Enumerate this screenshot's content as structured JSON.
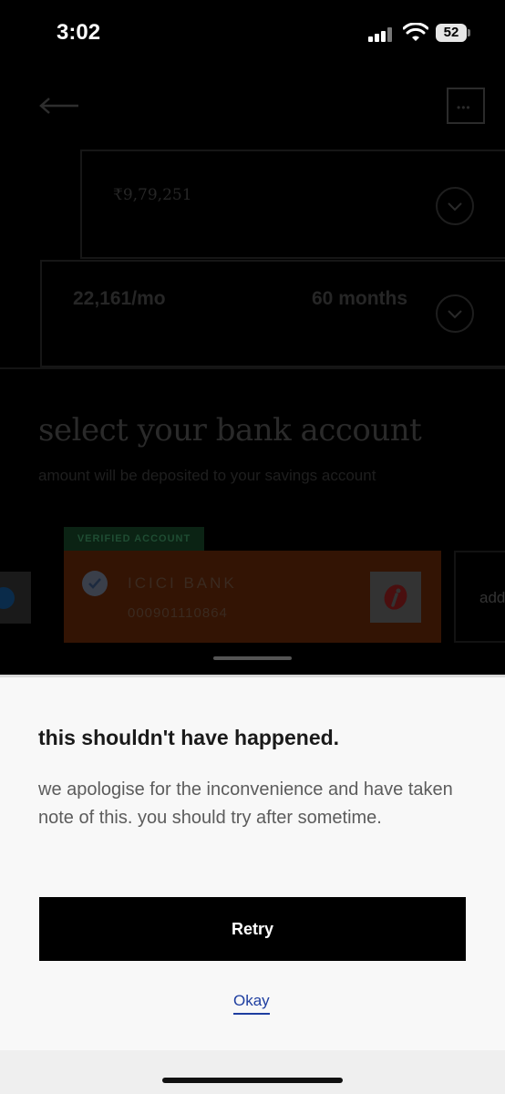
{
  "status_bar": {
    "time": "3:02",
    "battery": "52",
    "icons": [
      "cellular-signal-icon",
      "wifi-icon",
      "battery-icon"
    ]
  },
  "header": {
    "icons": [
      "back-arrow-icon",
      "chat-icon"
    ]
  },
  "loan": {
    "amount": "₹9,79,251",
    "emi": "22,161/mo",
    "tenure": "60 months"
  },
  "bank_section": {
    "title": "select your bank account",
    "subtitle": "amount will be deposited to your savings account",
    "verified_badge": "VERIFIED ACCOUNT",
    "bank_name": "ICICI BANK",
    "account_number": "000901110864",
    "next_card_label": "add"
  },
  "modal": {
    "title": "this shouldn't have happened.",
    "body": "we apologise for the inconvenience and have taken note of this. you should try after sometime.",
    "retry_label": "Retry",
    "okay_label": "Okay"
  },
  "colors": {
    "background": "#000000",
    "modal_bg": "#f8f8f8",
    "button_bg": "#000000",
    "link": "#1e3ea0",
    "bank_card_dimmed": "#331404"
  }
}
